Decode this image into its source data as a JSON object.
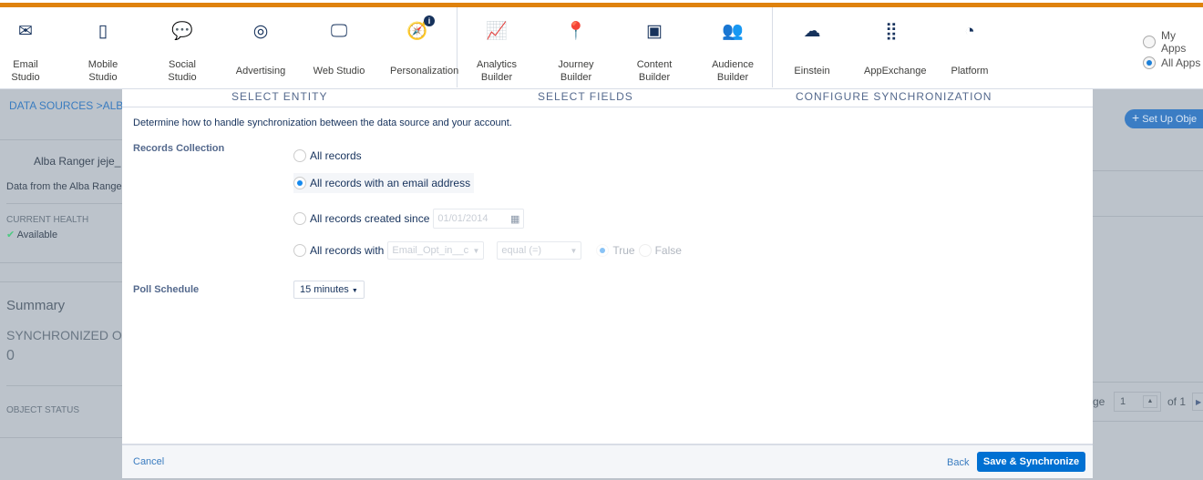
{
  "nav": {
    "items": [
      {
        "icon": "envelope-icon",
        "glyph": "✉",
        "label": "Email Studio"
      },
      {
        "icon": "mobile-icon",
        "glyph": "▯",
        "label": "Mobile Studio"
      },
      {
        "icon": "chat-bubbles-icon",
        "glyph": "💬",
        "label": "Social Studio"
      },
      {
        "icon": "advertising-icon",
        "glyph": "◎",
        "label": "Advertising"
      },
      {
        "icon": "monitor-icon",
        "glyph": "🖵",
        "label": "Web Studio"
      },
      {
        "icon": "compass-icon",
        "glyph": "🧭",
        "label": "Personalization",
        "badge": "i"
      },
      {
        "icon": "line-chart-icon",
        "glyph": "📈",
        "label": "Analytics Builder"
      },
      {
        "icon": "map-pin-icon",
        "glyph": "📍",
        "label": "Journey Builder"
      },
      {
        "icon": "layout-icon",
        "glyph": "▣",
        "label": "Content Builder"
      },
      {
        "icon": "people-icon",
        "glyph": "👥",
        "label": "Audience Builder"
      },
      {
        "icon": "einstein-icon",
        "glyph": "☁",
        "label": "Einstein"
      },
      {
        "icon": "grid-icon",
        "glyph": "⣿",
        "label": "AppExchange"
      },
      {
        "icon": "gauge-icon",
        "glyph": "◔",
        "label": "Platform"
      }
    ],
    "app_filter": {
      "options": [
        "My Apps",
        "All Apps"
      ],
      "selected": "All Apps"
    }
  },
  "background": {
    "breadcrumb": "DATA SOURCES >ALB",
    "source_name": "Alba Ranger jeje_",
    "source_desc": "Data from the Alba Range",
    "health_label": "CURRENT HEALTH",
    "health_value": "Available",
    "summary": "Summary",
    "synced_label": "SYNCHRONIZED O",
    "synced_value": "0",
    "object_status": "OBJECT STATUS",
    "setup_button": "Set Up Obje",
    "page_label": "ge",
    "page_value": "1",
    "page_of": "of 1"
  },
  "modal": {
    "steps": [
      "SELECT ENTITY",
      "SELECT FIELDS",
      "CONFIGURE SYNCHRONIZATION"
    ],
    "intro": "Determine how to handle synchronization between the data source and your account.",
    "records_label": "Records Collection",
    "options": [
      "All records",
      "All records with an email address",
      "All records created since",
      "All records with"
    ],
    "selected_option": 1,
    "date_placeholder": "01/01/2014",
    "field_select": "Email_Opt_in__c",
    "operator_select": "equal (=)",
    "bool_options": [
      "True",
      "False"
    ],
    "poll_label": "Poll Schedule",
    "poll_value": "15 minutes",
    "cancel": "Cancel",
    "back": "Back",
    "save": "Save & Synchronize"
  },
  "colors": {
    "accent": "#0070d2",
    "stripe": "#df820d"
  }
}
